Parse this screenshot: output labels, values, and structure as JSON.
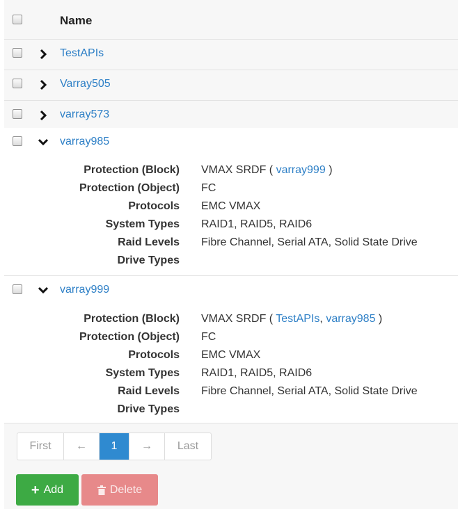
{
  "header": {
    "name_col": "Name"
  },
  "rows": [
    {
      "name": "TestAPIs",
      "expanded": false
    },
    {
      "name": "Varray505",
      "expanded": false
    },
    {
      "name": "varray573",
      "expanded": false
    },
    {
      "name": "varray985",
      "expanded": true,
      "details": {
        "protection_block_label": "Protection (Block)",
        "protection_block_value_prefix": "VMAX SRDF (",
        "protection_block_links": [
          "varray999"
        ],
        "protection_block_value_suffix": ")",
        "protection_object_label": "Protection (Object)",
        "protection_object_value": "FC",
        "protocols_label": "Protocols",
        "protocols_value": "EMC VMAX",
        "system_types_label": "System Types",
        "system_types_value": "RAID1, RAID5, RAID6",
        "raid_levels_label": "Raid Levels",
        "raid_levels_value": "Fibre Channel, Serial ATA, Solid State Drive",
        "drive_types_label": "Drive Types",
        "drive_types_value": ""
      }
    },
    {
      "name": "varray999",
      "expanded": true,
      "details": {
        "protection_block_label": "Protection (Block)",
        "protection_block_value_prefix": "VMAX SRDF (",
        "protection_block_links": [
          "TestAPIs",
          "varray985"
        ],
        "protection_block_value_suffix": ")",
        "protection_object_label": "Protection (Object)",
        "protection_object_value": "FC",
        "protocols_label": "Protocols",
        "protocols_value": "EMC VMAX",
        "system_types_label": "System Types",
        "system_types_value": "RAID1, RAID5, RAID6",
        "raid_levels_label": "Raid Levels",
        "raid_levels_value": "Fibre Channel, Serial ATA, Solid State Drive",
        "drive_types_label": "Drive Types",
        "drive_types_value": ""
      }
    }
  ],
  "pagination": {
    "first": "First",
    "prev": "←",
    "current": "1",
    "next": "→",
    "last": "Last"
  },
  "actions": {
    "add_label": "Add",
    "delete_label": "Delete"
  },
  "colors": {
    "link": "#2d7fc6",
    "add": "#3daa44",
    "delete": "#e7898a",
    "page_active": "#2f8ad0"
  }
}
